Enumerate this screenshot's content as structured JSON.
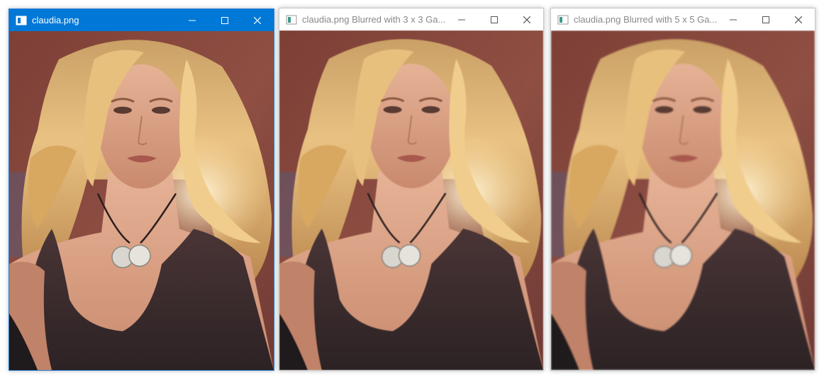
{
  "windows": [
    {
      "title": "claudia.png",
      "active": true,
      "image_name": "claudia.png",
      "blur": "none"
    },
    {
      "title": "claudia.png Blurred with 3 x 3 Ga...",
      "active": false,
      "image_name": "claudia.png",
      "blur": "3 x 3 Gaussian"
    },
    {
      "title": "claudia.png Blurred with 5 x 5 Ga...",
      "active": false,
      "image_name": "claudia.png",
      "blur": "5 x 5 Gaussian"
    }
  ],
  "controls": {
    "minimize": "minimize-icon",
    "maximize": "maximize-icon",
    "close": "close-icon"
  },
  "colors": {
    "active_titlebar": "#0078d7",
    "active_border": "#2d7fd6",
    "inactive_title_text": "#888888",
    "background_wall": "#8a4a3e",
    "hair": "#e2b46a",
    "skin": "#e0a688",
    "top": "#3a2b2c"
  }
}
